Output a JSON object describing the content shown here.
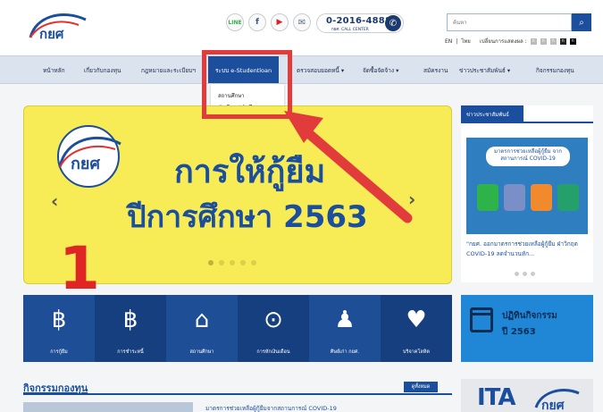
{
  "header": {
    "logo_text": "กยศ",
    "call": {
      "number": "0-2016-4888",
      "label": "กยศ. CALL CENTER"
    },
    "social": {
      "line": "LINE",
      "facebook": "f",
      "youtube": "▶",
      "mail": "✉"
    },
    "search": {
      "placeholder": "ค้นหา",
      "icon": "search-icon"
    },
    "lang": {
      "en": "EN",
      "th": "ไทย",
      "font_label": "เปลี่ยนการแสดงผล :"
    }
  },
  "nav": {
    "items": [
      {
        "label": "หน้าหลัก"
      },
      {
        "label": "เกี่ยวกับกองทุน"
      },
      {
        "label": "กฎหมายและระเบียบฯ"
      },
      {
        "label": "ระบบ e-Studentloan"
      },
      {
        "label": "ตรวจสอบยอดหนี้ ▾"
      },
      {
        "label": "จัดซื้อจัดจ้าง ▾"
      },
      {
        "label": "สมัครงาน"
      },
      {
        "label": "ข่าวประชาสัมพันธ์ ▾"
      },
      {
        "label": "กิจกรรมกองทุน"
      }
    ],
    "dropdown": [
      {
        "label": "สถานศึกษา"
      },
      {
        "label": "นักเรียน / นักศึกษา"
      }
    ]
  },
  "banner": {
    "title": "การให้กู้ยืม",
    "subtitle": "ปีการศึกษา 2563",
    "prev": "‹",
    "next": "›",
    "annotation": "1"
  },
  "news": {
    "tab": "ข่าวประชาสัมพันธ์",
    "image_head": "มาตรการช่วยเหลือผู้กู้ยืม จากสถานการณ์ COVID-19",
    "text": "\"กยศ. ออกมาตรการช่วยเหลือผู้กู้ยืม ฝ่าวิกฤต COVID-19 ลดจำนวนหัก..."
  },
  "services": [
    {
      "icon": "฿",
      "label": "การกู้ยืม"
    },
    {
      "icon": "฿",
      "label": "การชำระหนี้"
    },
    {
      "icon": "⌂",
      "label": "สถานศึกษา"
    },
    {
      "icon": "⊙",
      "label": "การหักเงินเดือน"
    },
    {
      "icon": "♟",
      "label": "ศิษย์เก่า กยศ."
    },
    {
      "icon": "♥",
      "label": "บริจาคโลหิต"
    }
  ],
  "calendar": {
    "line1": "ปฏิทินกิจกรรม",
    "line2": "ปี 2563"
  },
  "activities": {
    "title": "กิจกรรมกองทุน",
    "more": "ดูทั้งหมด",
    "headline": "มาตรการช่วยเหลือผู้กู้ยืมจากสถานการณ์ COVID-19"
  },
  "ita": {
    "text": "ITA"
  },
  "colors": {
    "brand": "#1b4f9e",
    "highlight": "#e23b3b",
    "banner": "#f7ec55"
  }
}
